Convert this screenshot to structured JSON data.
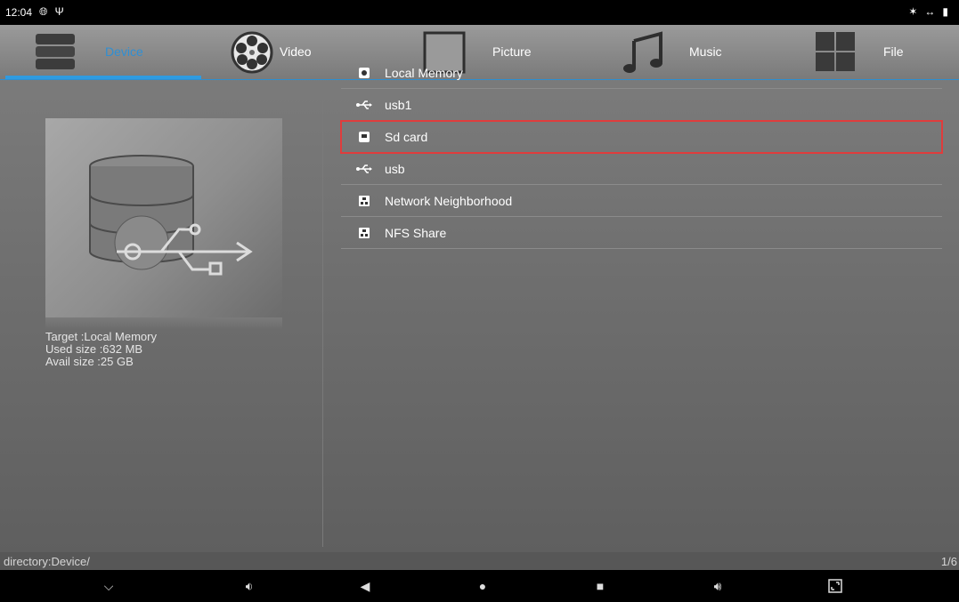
{
  "status_bar": {
    "time": "12:04",
    "left_icons": [
      "globe-icon",
      "usb-icon"
    ],
    "right_icons": [
      "bluetooth-icon",
      "data-arrows-icon",
      "battery-icon"
    ]
  },
  "tabs": [
    {
      "label": "Device",
      "icon": "database-icon",
      "active": true
    },
    {
      "label": "Video",
      "icon": "film-reel-icon",
      "active": false
    },
    {
      "label": "Picture",
      "icon": "picture-frame-icon",
      "active": false
    },
    {
      "label": "Music",
      "icon": "music-note-icon",
      "active": false
    },
    {
      "label": "File",
      "icon": "grid-icon",
      "active": false
    }
  ],
  "info": {
    "target": "Target :Local Memory",
    "used": "Used size :632 MB",
    "avail": "Avail size :25 GB"
  },
  "devices": [
    {
      "label": "Local Memory",
      "icon": "disk-icon",
      "selected": false
    },
    {
      "label": "usb1",
      "icon": "usb-icon",
      "selected": false
    },
    {
      "label": "Sd card",
      "icon": "sd-card-icon",
      "selected": true
    },
    {
      "label": "usb",
      "icon": "usb-icon",
      "selected": false
    },
    {
      "label": "Network Neighborhood",
      "icon": "network-icon",
      "selected": false
    },
    {
      "label": "NFS Share",
      "icon": "network-icon",
      "selected": false
    }
  ],
  "footer": {
    "directory": "directory:Device/",
    "page": "1/6"
  },
  "colors": {
    "accent": "#2f9be0",
    "selection_outline": "#e03c3c"
  }
}
